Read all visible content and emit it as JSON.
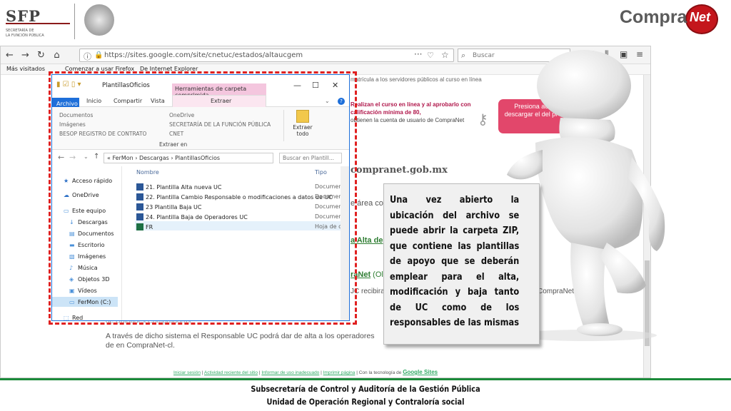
{
  "header": {
    "sfp_logo": "SFP",
    "sfp_subtitle_line1": "SECRETARÍA DE",
    "sfp_subtitle_line2": "LA FUNCIÓN PÚBLICA",
    "compranet_word": "Compra",
    "compranet_net": "Net"
  },
  "browser": {
    "url": "https://sites.google.com/site/cnetuc/estados/altaucgem",
    "search_placeholder": "Buscar",
    "bookmarks": [
      "Más visitados",
      "Comenzar a usar Firefox",
      "De Internet Explorer"
    ]
  },
  "webpage": {
    "top_clip": "matrícula a los servidores públicos al curso en línea",
    "red_text_1": "Realizan el curso en línea y al aprobarlo con",
    "red_text_2": "calificación mínima de 80,",
    "red_text_3": "obtienen la cuenta de usuario de CompraNet",
    "pink_button": "Presiona ac descargar el del pr",
    "domain": "compranet.gob.mx",
    "area_text": "e área co",
    "alta_link": "a Alta de",
    "compranet_link": "raNet",
    "compranet_link_tail": " (Ol",
    "uc_recibira": "JC recibira",
    "right_compranet_rc": "CompraNet-rc  si",
    "grey_clip": "de Unidades Compradoras.",
    "para_text": "A través de dicho sistema el Responsable UC podrá dar de alta a los operadores de en CompraNet-cl.",
    "footer_links": [
      "Iniciar sesión",
      "Actividad reciente del sitio",
      "Informar de uso inadecuado",
      "Imprimir página"
    ],
    "footer_tech": "Con la tecnología de",
    "footer_google": "Google Sites"
  },
  "explorer": {
    "title": "PlantillasOficios",
    "context_tab": "Herramientas de carpeta comprimida",
    "tabs": [
      "Archivo",
      "Inicio",
      "Compartir",
      "Vista"
    ],
    "context_subtab": "Extraer",
    "ribbon_left": [
      "Documentos",
      "Imágenes",
      "BESOP REGISTRO DE CONTRATO"
    ],
    "ribbon_right": [
      "OneDrive",
      "SECRETARÍA DE LA FUNCIÓN PÚBLICA",
      "CNET"
    ],
    "extraer_todo": "Extraer todo",
    "ribbon_group": "Extraer en",
    "breadcrumb": "«  FerMon  ›  Descargas  ›  PlantillasOficios",
    "search_placeholder": "Buscar en Plantill...",
    "nav_items": [
      "Acceso rápido",
      "OneDrive",
      "Este equipo",
      "Descargas",
      "Documentos",
      "Escritorio",
      "Imágenes",
      "Música",
      "Objetos 3D",
      "Vídeos",
      "FerMon (C:)",
      "Red"
    ],
    "col_name": "Nombre",
    "col_type": "Tipo",
    "files": [
      {
        "name": "21. Plantilla Alta nueva UC",
        "type": "Documento d"
      },
      {
        "name": "22. Plantilla Cambio Responsable o modificaciones a datos de UC",
        "type": "Documento d"
      },
      {
        "name": "23  Plantilla Baja UC",
        "type": "Documento d"
      },
      {
        "name": "24. Plantilla Baja de Operadores UC",
        "type": "Documento d"
      },
      {
        "name": "FR",
        "type": "Hoja de cálcu"
      }
    ]
  },
  "callout": {
    "text": "Una vez abierto la ubicación del archivo se puede abrir la carpeta ZIP, que contiene las plantillas de apoyo que se deberán emplear para el alta, modificación y baja tanto de UC como de los responsables de las mismas"
  },
  "footer": {
    "line1": "Subsecretaría de Control y Auditoría de la Gestión Pública",
    "line2": "Unidad de Operación Regional y Contraloría social"
  },
  "colors": {
    "brand_red": "#c4161c",
    "dashed_border": "#e02020",
    "footer_green": "#1b8a3a",
    "pink_button": "#e2476b",
    "windows_blue": "#1e6fd9"
  }
}
